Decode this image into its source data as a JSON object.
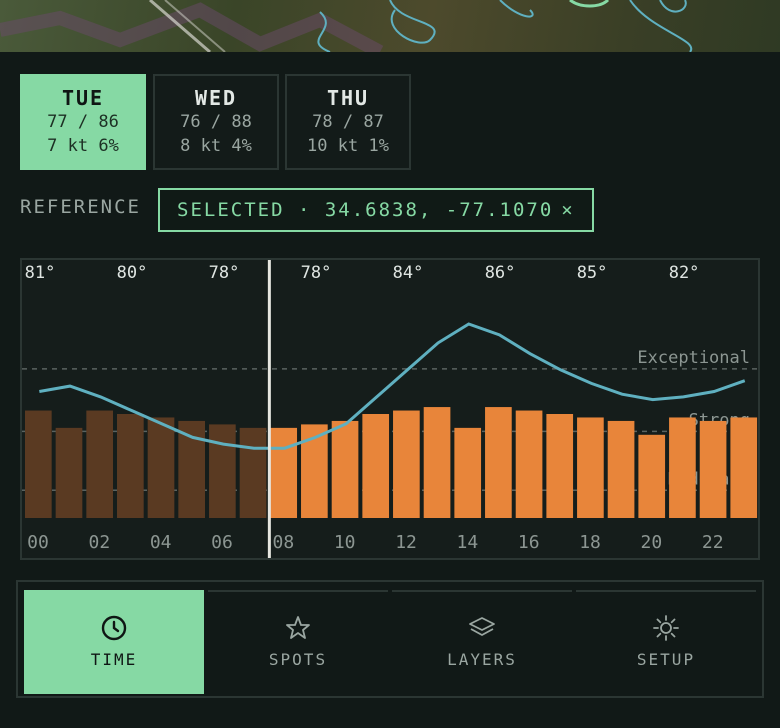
{
  "days": [
    {
      "name": "TUE",
      "temps": "77 / 86",
      "wind": "7 kt 6%",
      "active": true
    },
    {
      "name": "WED",
      "temps": "76 / 88",
      "wind": "8 kt 4%",
      "active": false
    },
    {
      "name": "THU",
      "temps": "78 / 87",
      "wind": "10 kt 1%",
      "active": false
    }
  ],
  "reference": {
    "label": "REFERENCE",
    "chip_text": "SELECTED · 34.6838, -77.1070",
    "close_glyph": "×"
  },
  "nav": [
    {
      "label": "TIME",
      "icon": "clock-icon",
      "active": true
    },
    {
      "label": "SPOTS",
      "icon": "star-icon",
      "active": false
    },
    {
      "label": "LAYERS",
      "icon": "layers-icon",
      "active": false
    },
    {
      "label": "SETUP",
      "icon": "sun-gear-icon",
      "active": false
    }
  ],
  "colors": {
    "accent": "#86d9a4",
    "bar_past": "#5a3a22",
    "bar_future": "#e8853a",
    "line": "#5fb0c0",
    "now_marker": "#e6e6e0"
  },
  "chart_data": {
    "type": "bar",
    "hours": [
      "00",
      "01",
      "02",
      "03",
      "04",
      "05",
      "06",
      "07",
      "08",
      "09",
      "10",
      "11",
      "12",
      "13",
      "14",
      "15",
      "16",
      "17",
      "18",
      "19",
      "20",
      "21",
      "22",
      "23"
    ],
    "x_tick_labels": [
      "00",
      "02",
      "04",
      "06",
      "08",
      "10",
      "12",
      "14",
      "16",
      "18",
      "20",
      "22"
    ],
    "values": [
      3.1,
      2.6,
      3.1,
      3.0,
      2.9,
      2.8,
      2.7,
      2.6,
      2.6,
      2.7,
      2.8,
      3.0,
      3.1,
      3.2,
      2.6,
      3.2,
      3.1,
      3.0,
      2.9,
      2.8,
      2.4,
      2.9,
      2.8,
      2.9
    ],
    "current_hour_index": 8,
    "thresholds": [
      {
        "name": "Exceptional",
        "value": 4.3
      },
      {
        "name": "Strong",
        "value": 2.5
      },
      {
        "name": "Moderate",
        "value": 0.8
      }
    ],
    "temperature_line": [
      81,
      81.4,
      80.6,
      79.6,
      78.6,
      77.6,
      77.1,
      76.8,
      76.8,
      77.6,
      78.6,
      80.6,
      82.6,
      84.6,
      86.0,
      85.2,
      83.8,
      82.6,
      81.6,
      80.8,
      80.4,
      80.6,
      81.0,
      81.8
    ],
    "temp_labels": [
      "81°",
      "80°",
      "78°",
      "78°",
      "84°",
      "86°",
      "85°",
      "82°"
    ],
    "ylim": [
      0,
      6
    ]
  }
}
